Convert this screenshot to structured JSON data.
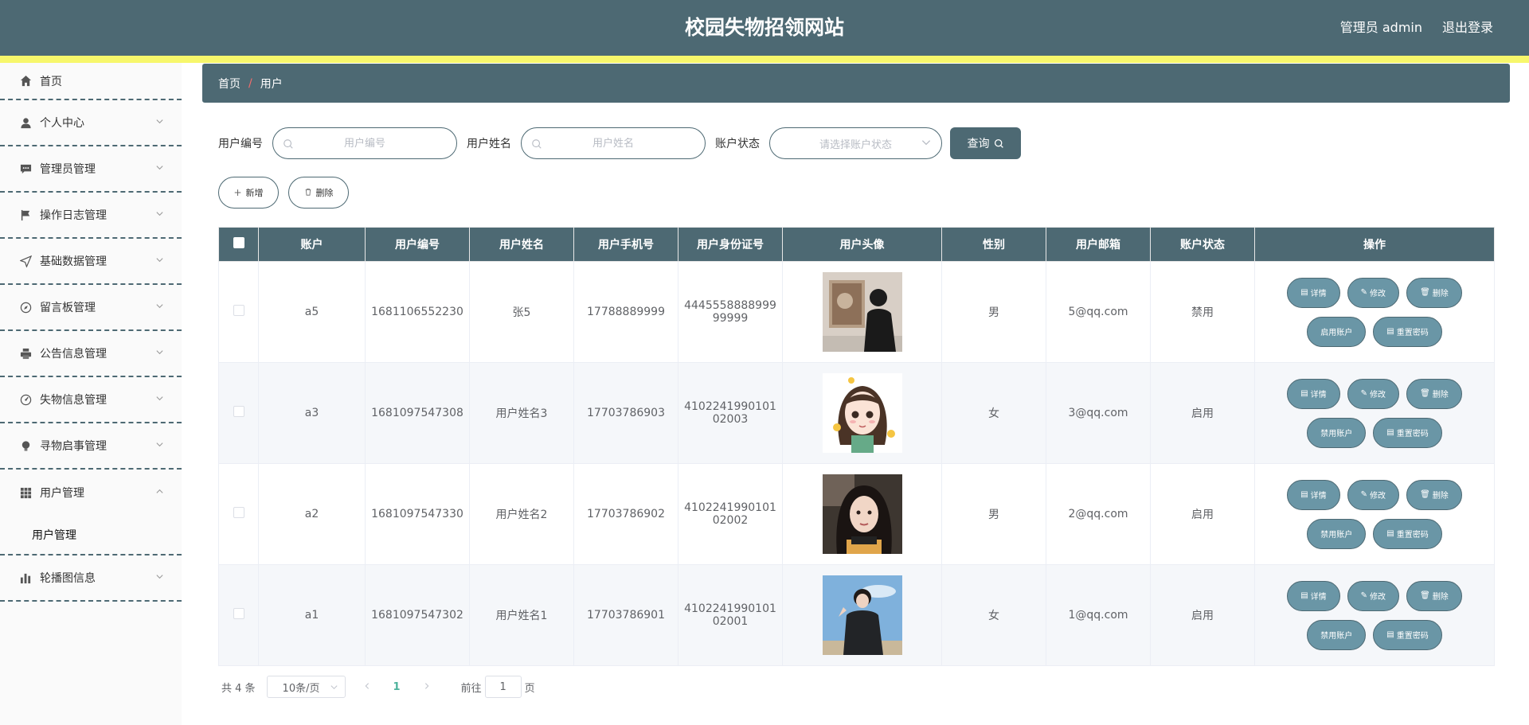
{
  "header": {
    "title": "校园失物招领网站",
    "user": "管理员 admin",
    "logout": "退出登录"
  },
  "sidebar": {
    "items": [
      {
        "label": "首页",
        "icon": "home-icon"
      },
      {
        "label": "个人中心",
        "icon": "user-icon"
      },
      {
        "label": "管理员管理",
        "icon": "chat-icon"
      },
      {
        "label": "操作日志管理",
        "icon": "flag-icon"
      },
      {
        "label": "基础数据管理",
        "icon": "send-icon"
      },
      {
        "label": "留言板管理",
        "icon": "compass-icon"
      },
      {
        "label": "公告信息管理",
        "icon": "printer-icon"
      },
      {
        "label": "失物信息管理",
        "icon": "gauge-icon"
      },
      {
        "label": "寻物启事管理",
        "icon": "bulb-icon"
      },
      {
        "label": "用户管理",
        "icon": "grid-icon",
        "sub": "用户管理"
      },
      {
        "label": "轮播图信息",
        "icon": "bar-chart-icon"
      }
    ]
  },
  "breadcrumb": {
    "home": "首页",
    "separator": "/",
    "current": "用户"
  },
  "search": {
    "code_label": "用户编号",
    "code_placeholder": "用户编号",
    "name_label": "用户姓名",
    "name_placeholder": "用户姓名",
    "status_label": "账户状态",
    "status_placeholder": "请选择账户状态",
    "query": "查询"
  },
  "actions": {
    "add": "新增",
    "delete": "删除"
  },
  "table": {
    "headers": [
      "账户",
      "用户编号",
      "用户姓名",
      "用户手机号",
      "用户身份证号",
      "用户头像",
      "性别",
      "用户邮箱",
      "账户状态",
      "操作"
    ],
    "rows": [
      {
        "account": "a5",
        "code": "1681106552230",
        "name": "张5",
        "phone": "17788889999",
        "id_line1": "4445558888999",
        "id_line2": "99999",
        "gender": "男",
        "email": "5@qq.com",
        "status": "禁用",
        "toggle": "启用账户",
        "avatar": "photo-man-back"
      },
      {
        "account": "a3",
        "code": "1681097547308",
        "name": "用户姓名3",
        "phone": "17703786903",
        "id_line1": "4102241990101",
        "id_line2": "02003",
        "gender": "女",
        "email": "3@qq.com",
        "status": "启用",
        "toggle": "禁用账户",
        "avatar": "cartoon-girl"
      },
      {
        "account": "a2",
        "code": "1681097547330",
        "name": "用户姓名2",
        "phone": "17703786902",
        "id_line1": "4102241990101",
        "id_line2": "02002",
        "gender": "男",
        "email": "2@qq.com",
        "status": "启用",
        "toggle": "禁用账户",
        "avatar": "photo-girl-selfie"
      },
      {
        "account": "a1",
        "code": "1681097547302",
        "name": "用户姓名1",
        "phone": "17703786901",
        "id_line1": "4102241990101",
        "id_line2": "02001",
        "gender": "女",
        "email": "1@qq.com",
        "status": "启用",
        "toggle": "禁用账户",
        "avatar": "photo-boy-sky"
      }
    ],
    "ops": {
      "detail": "详情",
      "edit": "修改",
      "delete": "删除",
      "reset": "重置密码"
    }
  },
  "pager": {
    "total": "共 4 条",
    "size": "10条/页",
    "current": "1",
    "goto": "前往",
    "goto_value": "1",
    "page_suffix": "页"
  },
  "colors": {
    "primary": "#4d6973",
    "accent_bar": "#f7f76b",
    "op_button": "#6a96a6",
    "page_active": "#4db29b"
  }
}
